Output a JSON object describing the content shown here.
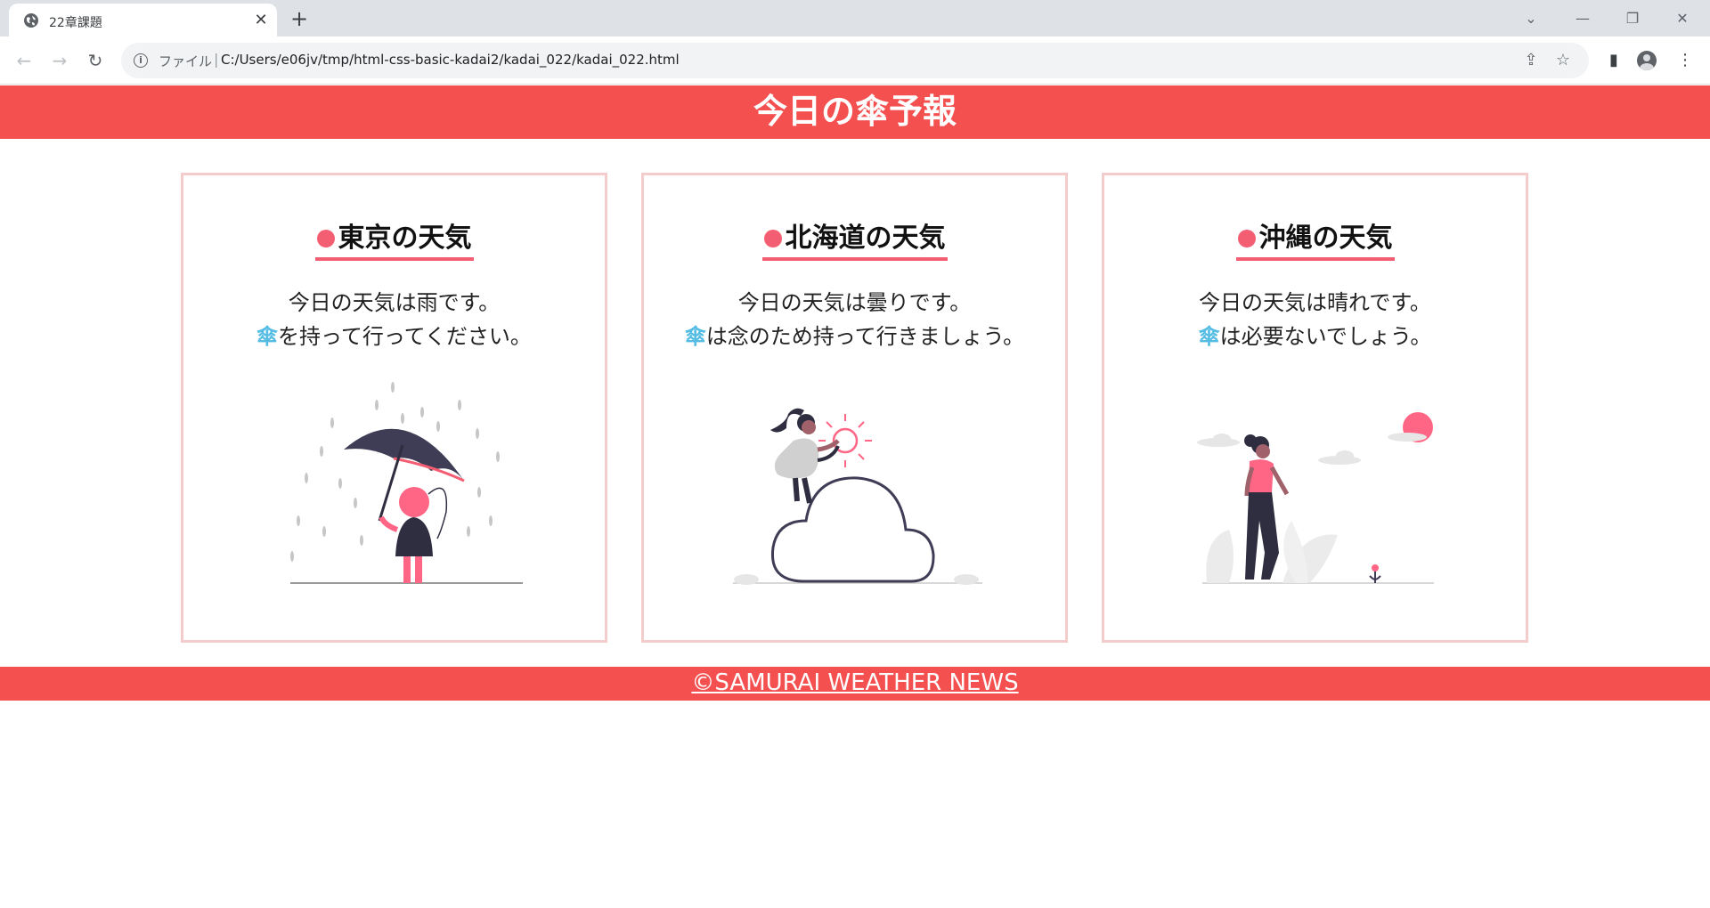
{
  "browser": {
    "tab_title": "22章課題",
    "scheme_label": "ファイル",
    "separator": "|",
    "url": "C:/Users/e06jv/tmp/html-css-basic-kadai2/kadai_022/kadai_022.html",
    "icons": {
      "favicon": "globe-icon",
      "close": "close-icon",
      "new_tab": "plus-icon",
      "back": "back-arrow-icon",
      "forward": "forward-arrow-icon",
      "reload": "reload-icon",
      "info": "info-icon",
      "share": "share-icon",
      "bookmark": "star-icon",
      "side_panel": "side-panel-icon",
      "profile": "profile-icon",
      "menu": "kebab-menu-icon",
      "tab_search": "chevron-down-icon",
      "minimize": "minimize-icon",
      "restore": "restore-icon",
      "window_close": "window-close-icon"
    }
  },
  "page": {
    "title": "今日の傘予報",
    "colors": {
      "primary": "#f45050",
      "accent": "#f45e72",
      "card_border": "#f4cccc",
      "umbrella_text": "#55bde4"
    },
    "cards": [
      {
        "heading": "東京の天気",
        "line1": "今日の天気は雨です。",
        "line2_icon": "傘",
        "line2_text": "を持って行ってください。",
        "illustration": "person-with-umbrella-in-rain"
      },
      {
        "heading": "北海道の天気",
        "line1": "今日の天気は曇りです。",
        "line2_icon": "傘",
        "line2_text": "は念のため持って行きましょう。",
        "illustration": "person-on-cloud-with-sun"
      },
      {
        "heading": "沖縄の天気",
        "line1": "今日の天気は晴れです。",
        "line2_icon": "傘",
        "line2_text": "は必要ないでしょう。",
        "illustration": "person-walking-sunny-day"
      }
    ],
    "footer": "©SAMURAI WEATHER NEWS"
  }
}
